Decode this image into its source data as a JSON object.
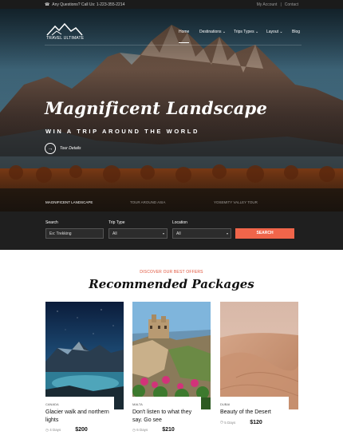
{
  "topbar": {
    "phone_icon": "phone-icon",
    "phone_text": "Any Questions? Call Us: 1-223-355-2214",
    "my_account": "My Account",
    "separator": "|",
    "contact": "Contact"
  },
  "brand": {
    "name": "TRAVEL ULTIMATE"
  },
  "nav": {
    "items": [
      {
        "label": "Home"
      },
      {
        "label": "Destinations"
      },
      {
        "label": "Trips Types"
      },
      {
        "label": "Layout"
      },
      {
        "label": "Blog"
      }
    ]
  },
  "hero": {
    "title": "Magnificent Landscape",
    "subtitle": "WIN A TRIP AROUND THE WORLD",
    "cta": "Tour Details",
    "slides": [
      {
        "label": "MAGNIFICENT LANDSCAPE"
      },
      {
        "label": "TOUR AROUND ASIA"
      },
      {
        "label": "YOSEMITY VALLEY TOUR"
      }
    ]
  },
  "search": {
    "search_label": "Search",
    "search_value": "Ex: Trekking",
    "trip_type_label": "Trip Type",
    "trip_type_value": "All",
    "location_label": "Location",
    "location_value": "All",
    "button": "SEARCH"
  },
  "packages": {
    "eyebrow": "DISCOVER OUR BEST OFFERS",
    "title": "Recommended Packages",
    "items": [
      {
        "country": "CANADA",
        "name": "Glacier walk and northern lights",
        "days": "4 Days",
        "price": "$200"
      },
      {
        "country": "MALTA",
        "name": "Don't listen to what they say. Go see",
        "days": "6 Days",
        "price": "$210"
      },
      {
        "country": "DUBAI",
        "name": "Beauty of the Desert",
        "days": "5 Days",
        "price": "$120"
      }
    ]
  },
  "colors": {
    "accent": "#f0654a",
    "dark": "#1f1f1f"
  }
}
